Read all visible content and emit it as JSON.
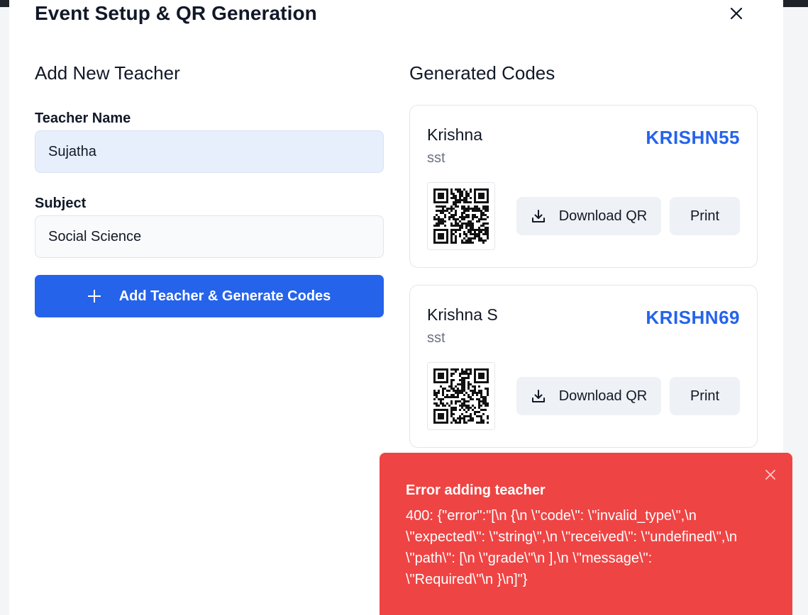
{
  "modal": {
    "title": "Event Setup & QR Generation"
  },
  "form": {
    "section_title": "Add New Teacher",
    "teacher_name_label": "Teacher Name",
    "teacher_name_value": "Sujatha",
    "subject_label": "Subject",
    "subject_value": "Social Science",
    "submit_label": "Add Teacher & Generate Codes"
  },
  "codes": {
    "section_title": "Generated Codes",
    "items": [
      {
        "name": "Krishna",
        "subject": "sst",
        "code": "KRISHN55",
        "download_label": "Download QR",
        "print_label": "Print"
      },
      {
        "name": "Krishna S",
        "subject": "sst",
        "code": "KRISHN69",
        "download_label": "Download QR",
        "print_label": "Print"
      }
    ]
  },
  "toast": {
    "title": "Error adding teacher",
    "message": "400: {\"error\":\"[\\n {\\n \\\"code\\\": \\\"invalid_type\\\",\\n \\\"expected\\\": \\\"string\\\",\\n \\\"received\\\": \\\"undefined\\\",\\n \\\"path\\\": [\\n \\\"grade\\\"\\n ],\\n \\\"message\\\": \\\"Required\\\"\\n }\\n]\"}",
    "color": "#ef4444"
  },
  "colors": {
    "accent": "#2563eb",
    "error": "#ef4444"
  },
  "icons": {
    "close": "close-icon",
    "plus": "plus-icon",
    "download": "download-icon",
    "qr": "qr-code-icon"
  }
}
